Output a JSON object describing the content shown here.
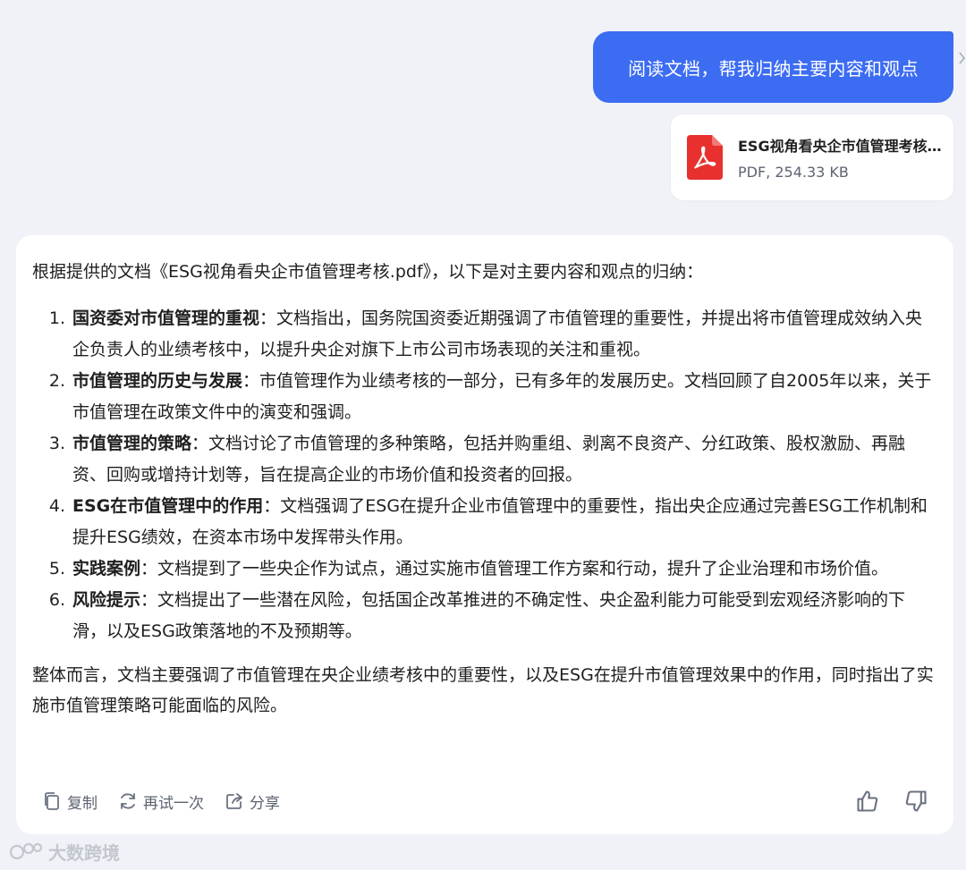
{
  "user_message": "阅读文档，帮我归纳主要内容和观点",
  "attachment": {
    "name": "ESG视角看央企市值管理考核.pdf",
    "meta": "PDF, 254.33 KB",
    "icon": "pdf-file-icon",
    "icon_color": "#e8302e"
  },
  "answer": {
    "intro": "根据提供的文档《ESG视角看央企市值管理考核.pdf》，以下是对主要内容和观点的归纳：",
    "points": [
      {
        "num": "1.",
        "title": "国资委对市值管理的重视",
        "text": "：文档指出，国务院国资委近期强调了市值管理的重要性，并提出将市值管理成效纳入央企负责人的业绩考核中，以提升央企对旗下上市公司市场表现的关注和重视。"
      },
      {
        "num": "2.",
        "title": "市值管理的历史与发展",
        "text": "：市值管理作为业绩考核的一部分，已有多年的发展历史。文档回顾了自2005年以来，关于市值管理在政策文件中的演变和强调。"
      },
      {
        "num": "3.",
        "title": "市值管理的策略",
        "text": "：文档讨论了市值管理的多种策略，包括并购重组、剥离不良资产、分红政策、股权激励、再融资、回购或增持计划等，旨在提高企业的市场价值和投资者的回报。"
      },
      {
        "num": "4.",
        "title": "ESG在市值管理中的作用",
        "text": "：文档强调了ESG在提升企业市值管理中的重要性，指出央企应通过完善ESG工作机制和提升ESG绩效，在资本市场中发挥带头作用。"
      },
      {
        "num": "5.",
        "title": "实践案例",
        "text": "：文档提到了一些央企作为试点，通过实施市值管理工作方案和行动，提升了企业治理和市场价值。"
      },
      {
        "num": "6.",
        "title": "风险提示",
        "text": "：文档提出了一些潜在风险，包括国企改革推进的不确定性、央企盈利能力可能受到宏观经济影响的下滑，以及ESG政策落地的不及预期等。"
      }
    ],
    "summary": "整体而言，文档主要强调了市值管理在央企业绩考核中的重要性，以及ESG在提升市值管理效果中的作用，同时指出了实施市值管理策略可能面临的风险。"
  },
  "actions": {
    "copy": "复制",
    "retry": "再试一次",
    "share": "分享"
  },
  "watermark": "大数跨境",
  "colors": {
    "accent": "#3c6cf2",
    "background": "#f0f2f7",
    "muted": "#5d6371"
  }
}
